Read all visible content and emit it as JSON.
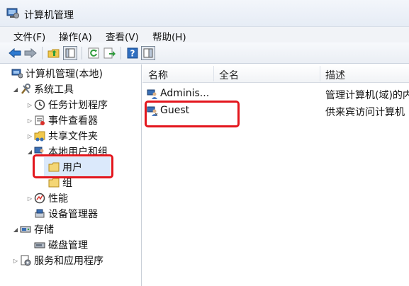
{
  "window": {
    "title": "计算机管理"
  },
  "menu": [
    "文件(F)",
    "操作(A)",
    "查看(V)",
    "帮助(H)"
  ],
  "toolbar": {
    "buttons": [
      "back-arrow-icon",
      "forward-arrow-icon",
      "up-folder-icon",
      "show-hide-tree-icon",
      "refresh-icon",
      "export-list-icon",
      "help-icon",
      "properties-view-icon"
    ]
  },
  "tree": {
    "root": "计算机管理(本地)",
    "system_tools": "系统工具",
    "task_scheduler": "任务计划程序",
    "event_viewer": "事件查看器",
    "shared_folders": "共享文件夹",
    "local_users_groups": "本地用户和组",
    "users": "用户",
    "groups": "组",
    "performance": "性能",
    "device_manager": "设备管理器",
    "storage": "存储",
    "disk_management": "磁盘管理",
    "services_apps": "服务和应用程序",
    "selected": "用户"
  },
  "list": {
    "columns": [
      "名称",
      "全名",
      "描述"
    ],
    "rows": [
      {
        "name": "Adminis...",
        "fullname": "",
        "description": "管理计算机(域)的内"
      },
      {
        "name": "Guest",
        "fullname": "",
        "description": "供来宾访问计算机"
      }
    ]
  },
  "colors": {
    "highlight": "#e3161d",
    "selection": "#dbe9fb"
  }
}
